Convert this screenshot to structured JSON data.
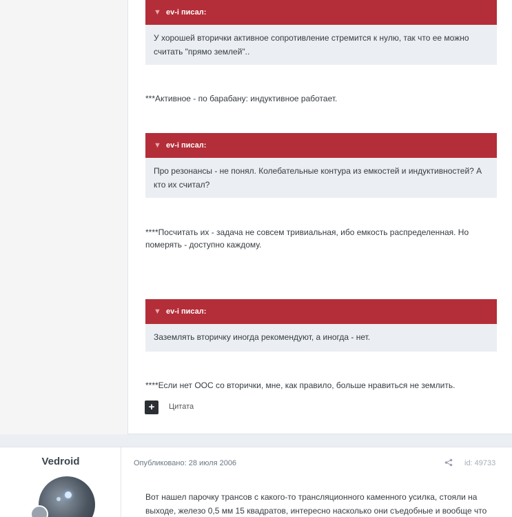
{
  "post1": {
    "quotes": [
      {
        "author": "ev-i писал:",
        "text": "У хорошей вторички активное сопротивление стремится к нулю, так что ее можно считать \"прямо землей\".."
      },
      {
        "author": "ev-i писал:",
        "text": "Про резонансы - не понял. Колебательные контура из емкостей и индуктивностей? А кто их считал?"
      },
      {
        "author": "ev-i писал:",
        "text": "Заземлять вторичку иногда рекомендуют, а иногда - нет."
      }
    ],
    "replies": [
      "***Активное - по барабану: индуктивное работает.",
      "****Посчитать их - задача не совсем тривиальная, ибо емкость распределенная. Но померять - доступно каждому.",
      "****Если нет ООС со вторички, мне, как правило, больше нравиться не землить."
    ],
    "quote_button_icon": "+",
    "quote_label": "Цитата"
  },
  "post2": {
    "author": "Vedroid",
    "published": "Опубликовано: 28 июля 2006",
    "share_icon": "share-icon",
    "id": "id: 49733",
    "text": "Вот нашел парочку трансов с какого-то трансляционного каменного усилка, стояли на выходе, железо 0,5 мм 15 квадратов, интересно насколько они съедобные и вообще что"
  },
  "colors": {
    "quote_header": "#b32e38",
    "quote_body": "#ebeef2",
    "author_column": "#f5f5f5"
  }
}
